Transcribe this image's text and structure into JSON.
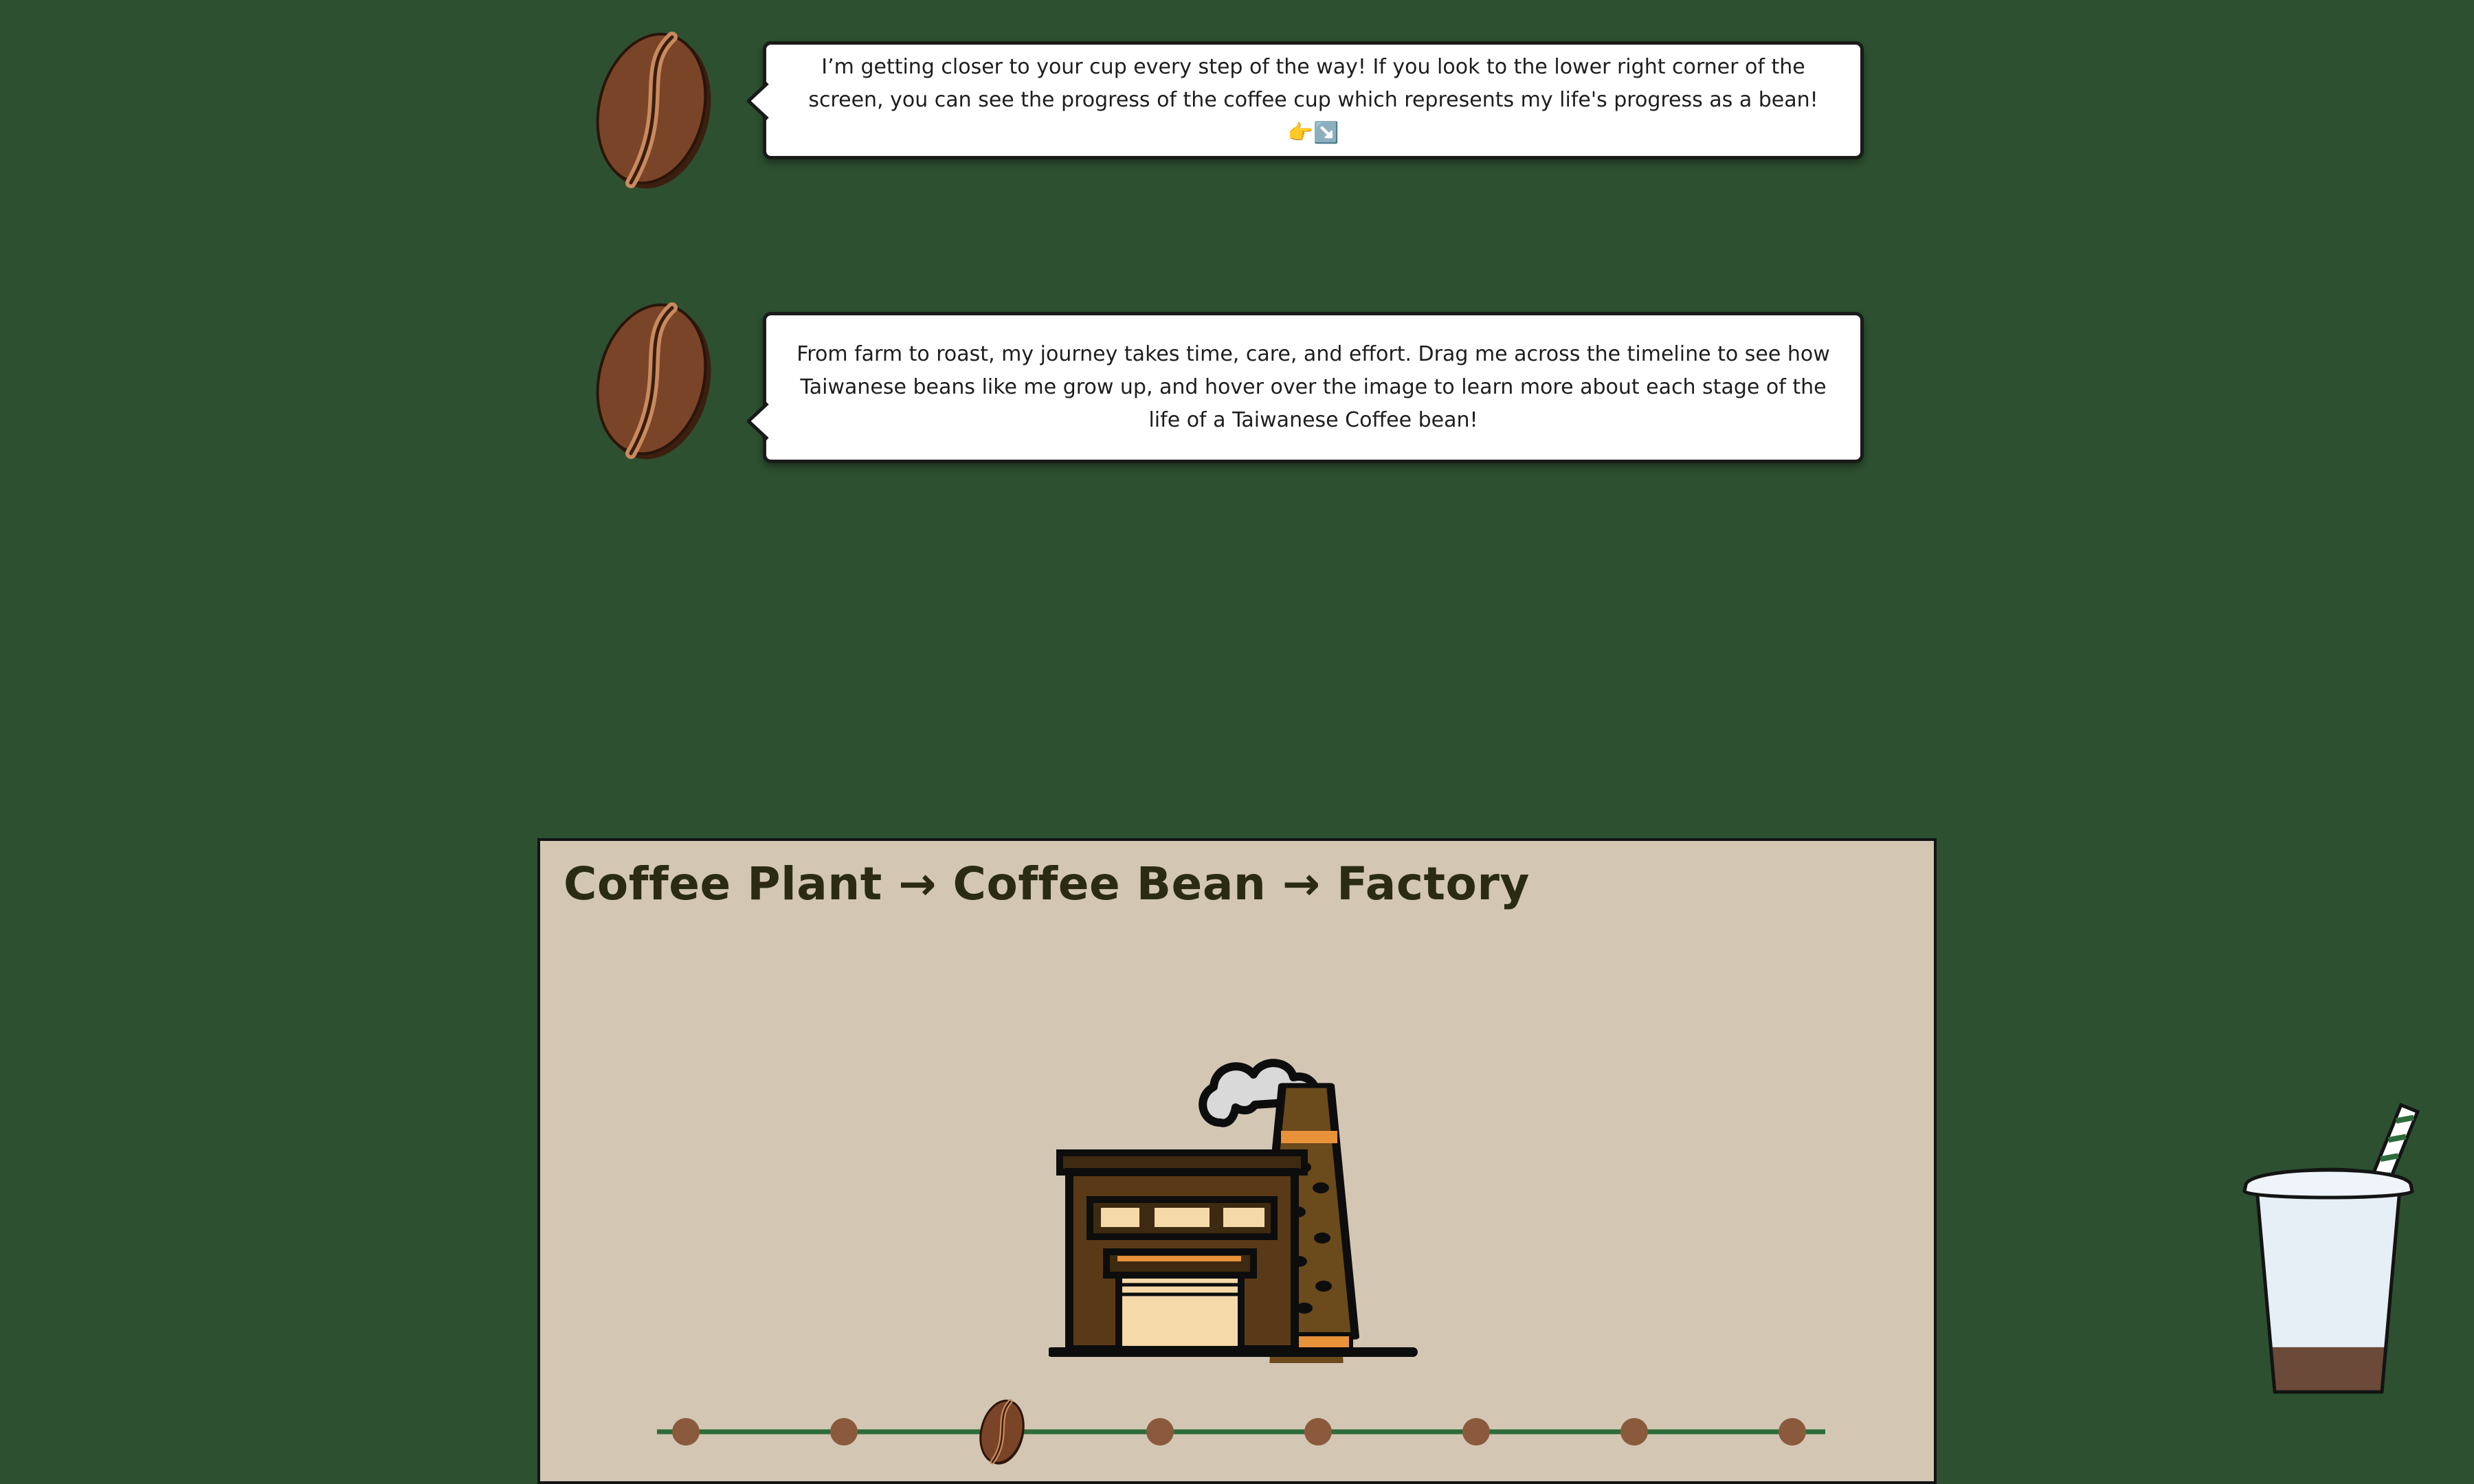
{
  "messages": [
    {
      "text": "I’m getting closer to your cup every step of the way! If you look to the lower right corner of the screen, you can see the progress of the coffee cup which represents my life's progress as a bean!👉↘️"
    },
    {
      "text": "From farm to roast, my journey takes time, care, and effort. Drag me across the timeline to see how Taiwanese beans like me grow up, and hover over the image to learn more about each stage of the life of a Taiwanese Coffee bean!"
    }
  ],
  "stage": {
    "title": "Coffee Plant → Coffee Bean → Factory",
    "image_icon": "factory-icon"
  },
  "timeline": {
    "stop_count": 8,
    "current_stop_index": 2,
    "handle_icon": "coffee-bean-handle-icon"
  },
  "cup_progress": {
    "icon": "iced-coffee-cup-icon",
    "fill_fraction": 0.22
  },
  "colors": {
    "background": "#2d5030",
    "card": "#d3c7b4",
    "title": "#2b2b14",
    "bean": "#7a4428",
    "bean_highlight": "#c98a5e",
    "timeline_line": "#2d6b3a",
    "timeline_dot": "#8b5a3c",
    "coffee": "#6b4a3a",
    "cup": "#e6eff6",
    "factory_brown": "#5a3a16",
    "factory_orange": "#e8923a",
    "factory_cream": "#f5d9a8"
  }
}
